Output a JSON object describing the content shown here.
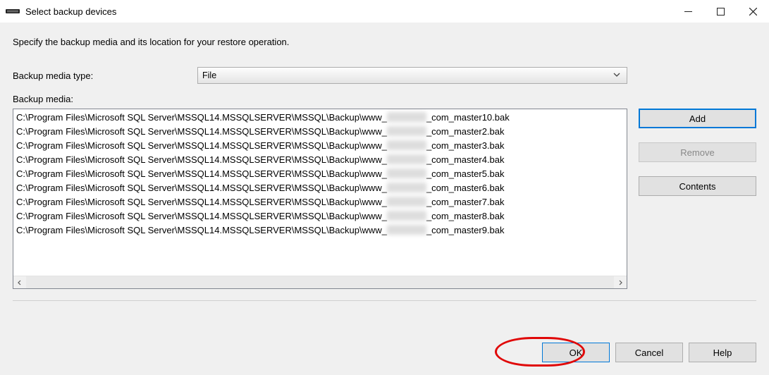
{
  "title": "Select backup devices",
  "instruction": "Specify the backup media and its location for your restore operation.",
  "labels": {
    "media_type": "Backup media type:",
    "media": "Backup media:"
  },
  "combo": {
    "selected": "File"
  },
  "items_prefix": "C:\\Program Files\\Microsoft SQL Server\\MSSQL14.MSSQLSERVER\\MSSQL\\Backup\\www_",
  "items_suffix": [
    "_com_master10.bak",
    "_com_master2.bak",
    "_com_master3.bak",
    "_com_master4.bak",
    "_com_master5.bak",
    "_com_master6.bak",
    "_com_master7.bak",
    "_com_master8.bak",
    "_com_master9.bak"
  ],
  "buttons": {
    "add": "Add",
    "remove": "Remove",
    "contents": "Contents",
    "ok": "OK",
    "cancel": "Cancel",
    "help": "Help"
  }
}
